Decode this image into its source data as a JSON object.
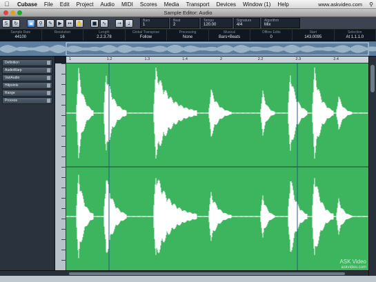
{
  "menubar": {
    "app": "Cubase",
    "items": [
      "File",
      "Edit",
      "Project",
      "Audio",
      "MIDI",
      "Scores",
      "Media",
      "Transport",
      "Devices",
      "Window (1)",
      "Help"
    ],
    "url": "www.askvideo.com"
  },
  "window": {
    "title": "Sample Editor: Audio"
  },
  "toolbar": {
    "boxes": [
      {
        "label": "Bars",
        "value": "1"
      },
      {
        "label": "Beat",
        "value": "2"
      },
      {
        "label": "Tempo",
        "value": "120.00"
      },
      {
        "label": "Signature",
        "value": "4/4"
      },
      {
        "label": "Algorithm",
        "value": "Mix"
      }
    ]
  },
  "infoline": [
    {
      "h": "Sample Rate",
      "v": "44100"
    },
    {
      "h": "Resolution",
      "v": "16"
    },
    {
      "h": "Length",
      "v": "2.2.3.78"
    },
    {
      "h": "Global Transpose",
      "v": "Follow"
    },
    {
      "h": "Processing",
      "v": "None"
    },
    {
      "h": "Musical",
      "v": "Bars+Beats"
    },
    {
      "h": "Offline Edits",
      "v": "0"
    },
    {
      "h": "Start",
      "v": "143.0095"
    },
    {
      "h": "Selection",
      "v": "At 1.1.1.0"
    }
  ],
  "ruler": {
    "labels": [
      "1",
      "1.2",
      "1.3",
      "1.4",
      "2",
      "2.2",
      "2.3",
      "2.4"
    ]
  },
  "inspector": {
    "items": [
      "Definition",
      "AudioWarp",
      "VariAudio",
      "Hitpoints",
      "Range",
      "Process"
    ]
  },
  "watermark": {
    "line1": "ASK Video",
    "line2": "askvideo.com"
  },
  "colors": {
    "waveform_bg": "#3cb55e",
    "waveform": "#ffffff"
  }
}
